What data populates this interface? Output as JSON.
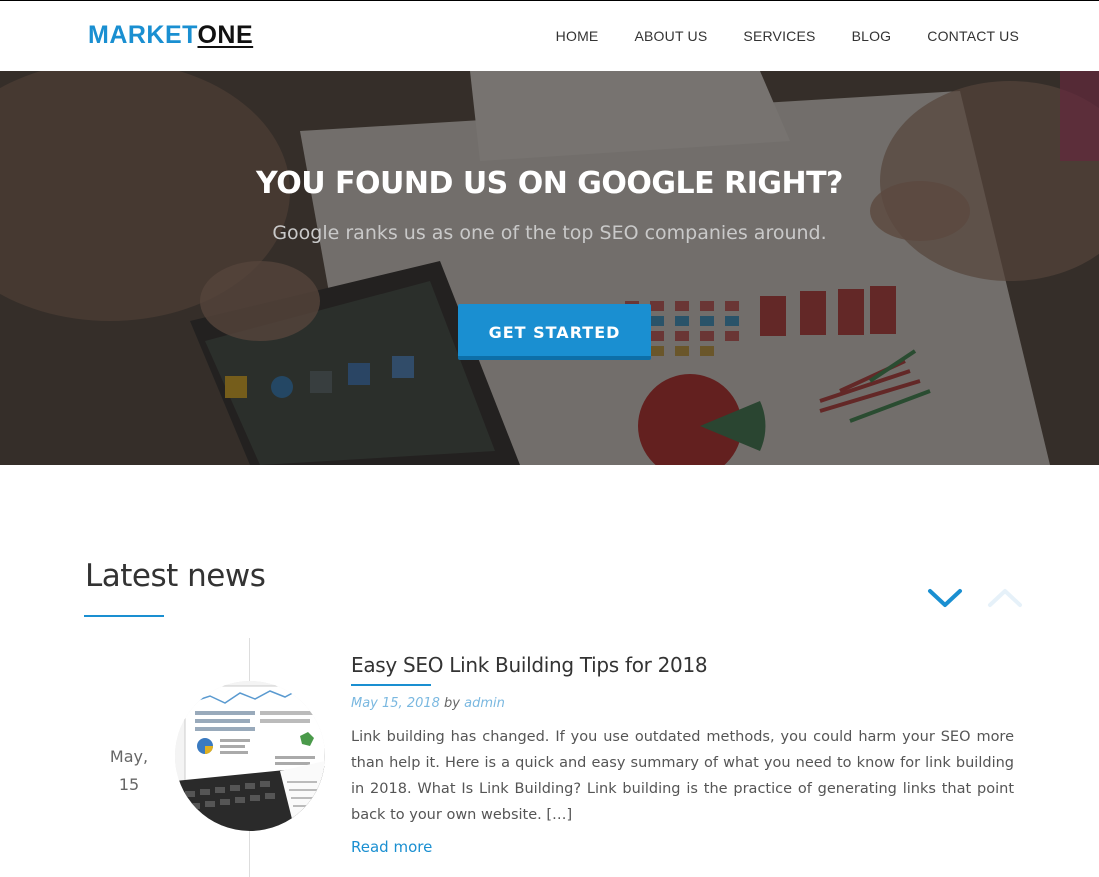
{
  "header": {
    "logo_part1": "MARKET",
    "logo_part2": "ONE",
    "nav": [
      "HOME",
      "ABOUT US",
      "SERVICES",
      "BLOG",
      "CONTACT US"
    ]
  },
  "hero": {
    "title": "YOU FOUND US ON GOOGLE RIGHT?",
    "subtitle": "Google ranks us as one of the top SEO companies around.",
    "cta_label": "GET STARTED",
    "background_image": "hands-tablet-charts-photo"
  },
  "news": {
    "section_title": "Latest news",
    "prev_icon": "chevron-down-icon",
    "next_icon": "chevron-up-icon",
    "posts": [
      {
        "date_month": "May,",
        "date_day": "15",
        "thumbnail": "laptop-analytics-photo",
        "title": "Easy SEO Link Building Tips for 2018",
        "date": "May 15, 2018",
        "by": "by",
        "author": "admin",
        "excerpt": "Link building has changed. If you use outdated methods, you could harm your SEO more than help it. Here is a quick and easy summary of what you need to know for link building in 2018. What Is Link Building? Link building is the practice of generating links that point back to your own website. […]",
        "read_more": "Read more"
      }
    ]
  },
  "colors": {
    "accent": "#1a8fd1",
    "text": "#333333",
    "nav_text": "#333333"
  }
}
